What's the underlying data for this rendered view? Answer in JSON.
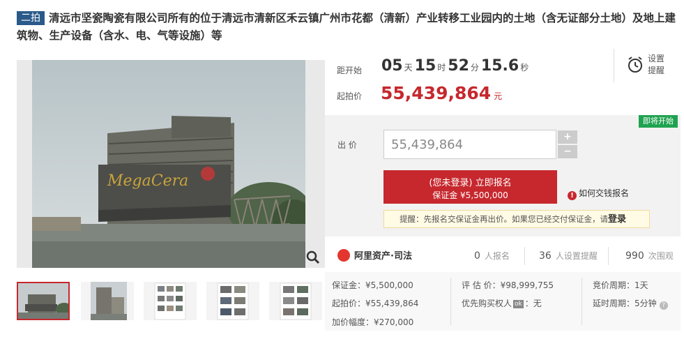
{
  "title": {
    "badge": "二拍",
    "text": "清远市坚瓷陶瓷有限公司所有的位于清远市清新区禾云镇广州市花都（清新）产业转移工业园内的土地（含无证部分土地）及地上建筑物、生产设备（含水、电、气等设施）等"
  },
  "countdown": {
    "label": "距开始",
    "days": "05",
    "days_unit": "天",
    "hours": "15",
    "hours_unit": "时",
    "minutes": "52",
    "minutes_unit": "分",
    "seconds": "15.6",
    "seconds_unit": "秒"
  },
  "reminder": {
    "line1": "设置",
    "line2": "提醒"
  },
  "start_price": {
    "label": "起拍价",
    "value": "55,439,864",
    "unit": "元"
  },
  "bid": {
    "status_tag": "即将开始",
    "label": "出  价",
    "input_value": "55,439,864",
    "plus": "+",
    "minus": "−",
    "signup_line1": "(您未登录) 立即报名",
    "signup_line2": "保证金 ¥5,500,000",
    "howto": "如何交钱报名",
    "tip_text": "提醒：先报名交保证金再出价。如果您已经交付保证金，请",
    "tip_link": "登录"
  },
  "platform": {
    "name": "阿里资产·司法",
    "signups_n": "0",
    "signups_label": "人报名",
    "reminders_n": "36",
    "reminders_label": "人设置提醒",
    "views_n": "990",
    "views_label": "次围观"
  },
  "details": {
    "deposit": "保证金：¥5,500,000",
    "start_price": "起拍价：¥55,439,864",
    "increment": "加价幅度：¥270,000",
    "appraisal": "评 估 价：¥98,999,755",
    "priority_label": "优先购买权人",
    "priority_badge": "ok",
    "priority_value": "：无",
    "cycle": "竞价周期：1天",
    "delay": "延时周期：5分钟"
  },
  "photo": {
    "sign_text": "MegaCera"
  }
}
